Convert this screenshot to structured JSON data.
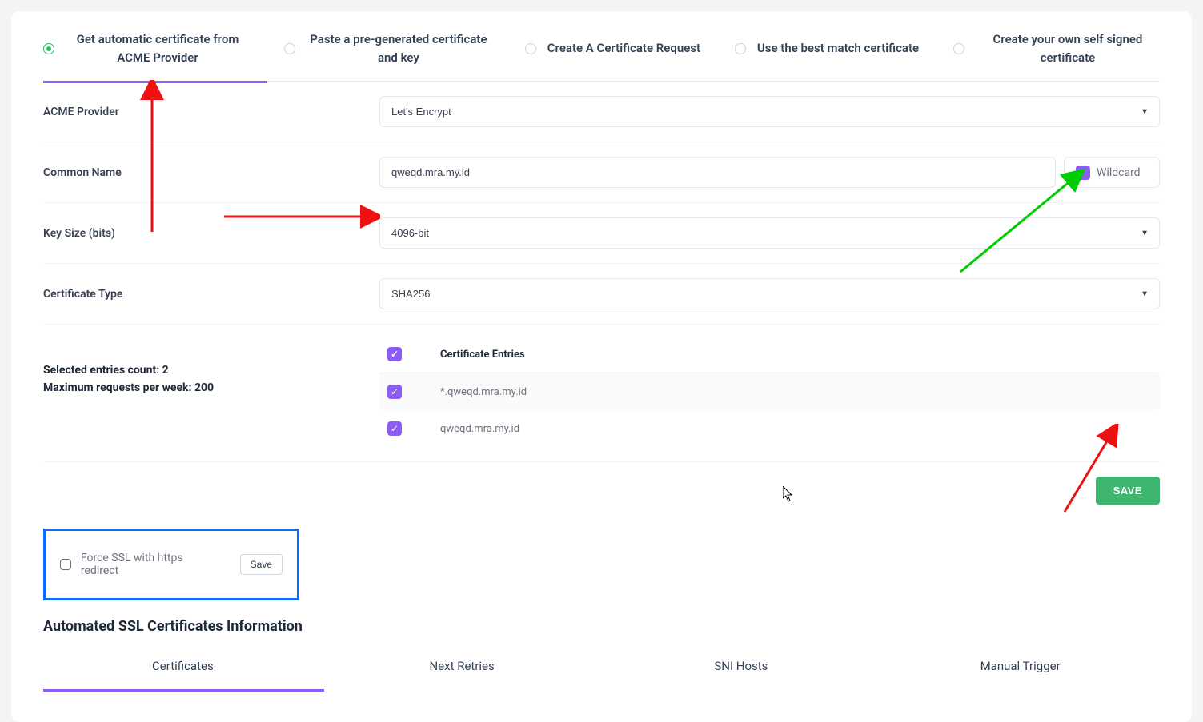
{
  "certTabs": {
    "opt1": "Get automatic certificate from ACME Provider",
    "opt2": "Paste a pre-generated certificate and key",
    "opt3": "Create A Certificate Request",
    "opt4": "Use the best match certificate",
    "opt5": "Create your own self signed certificate"
  },
  "labels": {
    "acmeProvider": "ACME Provider",
    "commonName": "Common Name",
    "keySize": "Key Size (bits)",
    "certType": "Certificate Type",
    "wildcard": "Wildcard",
    "certEntriesHeader": "Certificate Entries",
    "selectedCountLine": "Selected entries count: 2",
    "maxRequestsLine": "Maximum requests per week: 200",
    "forceSsl": "Force SSL with https redirect",
    "miniSave": "Save",
    "save": "SAVE",
    "sectionTitle": "Automated SSL Certificates Information"
  },
  "values": {
    "acmeProvider": "Let's Encrypt",
    "commonName": "qweqd.mra.my.id",
    "keySize": "4096-bit",
    "certType": "SHA256"
  },
  "entries": {
    "e1": "*.qweqd.mra.my.id",
    "e2": "qweqd.mra.my.id"
  },
  "bottomTabs": {
    "t1": "Certificates",
    "t2": "Next Retries",
    "t3": "SNI Hosts",
    "t4": "Manual Trigger"
  }
}
